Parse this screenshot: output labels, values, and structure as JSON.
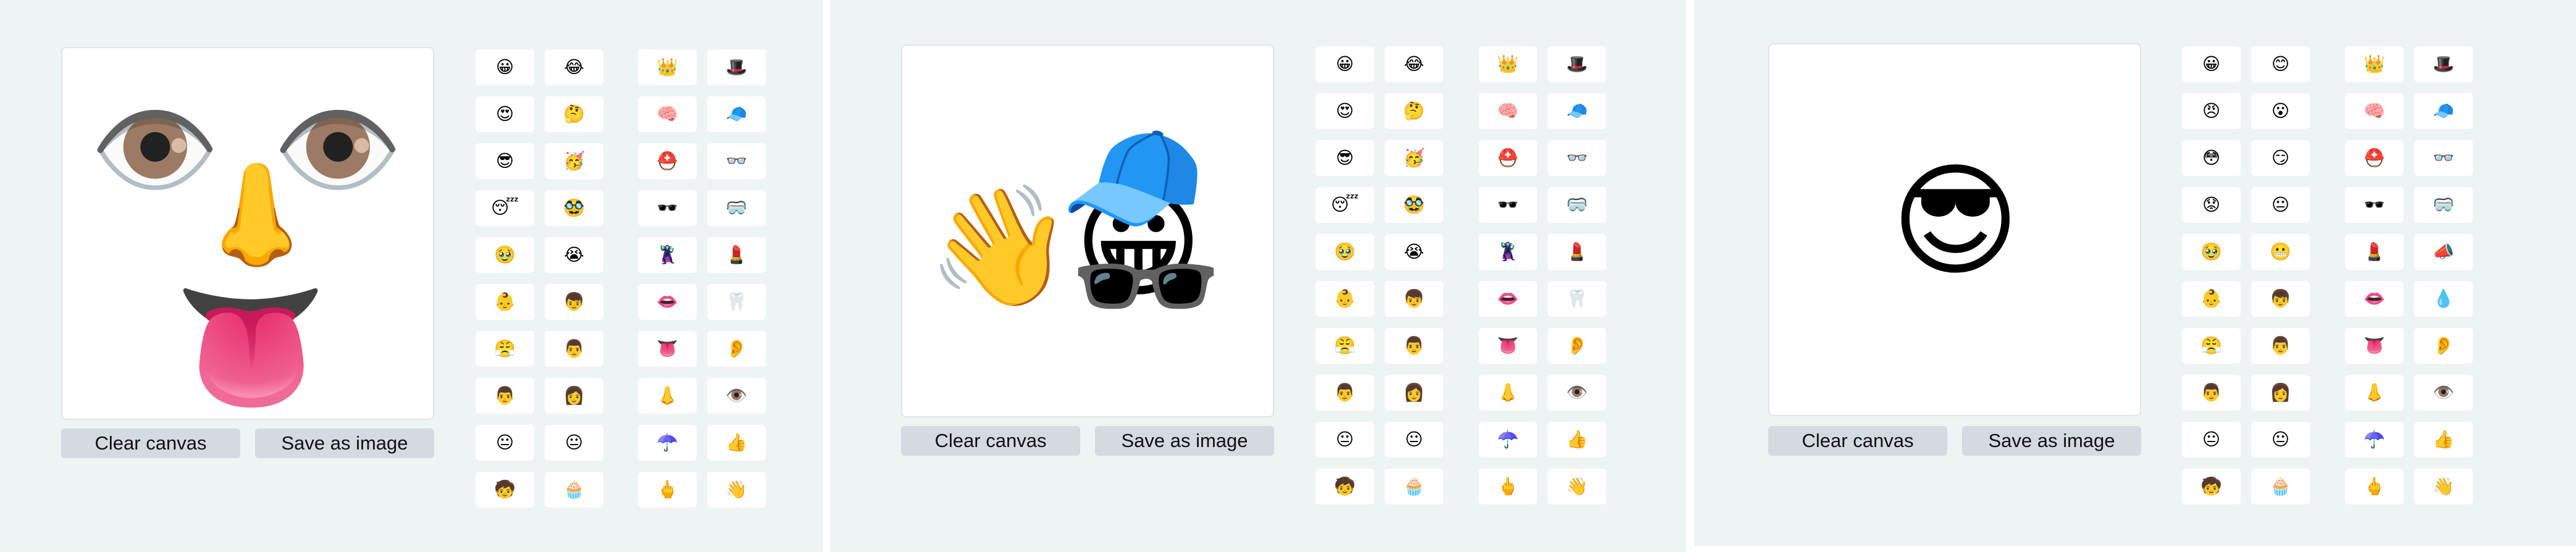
{
  "panels": [
    {
      "placed": [
        {
          "emoji": "👁️",
          "name": "left-eye"
        },
        {
          "emoji": "👁️",
          "name": "right-eye"
        },
        {
          "emoji": "👃",
          "name": "nose"
        },
        {
          "emoji": "👅",
          "name": "tongue"
        }
      ],
      "buttons": {
        "clear": "Clear canvas",
        "save": "Save as image"
      },
      "palette_a": [
        "😀",
        "😂",
        "😍",
        "🤔",
        "😎",
        "🥳",
        "😴",
        "🥸",
        "🥹",
        "😭",
        "👶",
        "👦",
        "😤",
        "👨",
        "👨",
        "👩",
        "😐",
        "😐",
        "🧒",
        "🧁"
      ],
      "palette_b": [
        "👑",
        "🎩",
        "🧠",
        "🧢",
        "⛑️",
        "👓",
        "🕶️",
        "🥽",
        "🦹",
        "💄",
        "👄",
        "🦷",
        "👅",
        "👂",
        "👃",
        "👁️",
        "☂️",
        "👍",
        "🖕",
        "👋"
      ]
    },
    {
      "placed": [
        {
          "emoji": "👋",
          "name": "waving-hand"
        },
        {
          "emoji": "😀",
          "name": "face"
        },
        {
          "emoji": "🧢",
          "name": "blue-cap"
        },
        {
          "emoji": "🕶️",
          "name": "sunglasses"
        }
      ],
      "buttons": {
        "clear": "Clear canvas",
        "save": "Save as image"
      },
      "palette_a": [
        "😀",
        "😂",
        "😍",
        "🤔",
        "😎",
        "🥳",
        "😴",
        "🥸",
        "🥹",
        "😭",
        "👶",
        "👦",
        "😤",
        "👨",
        "👨",
        "👩",
        "😐",
        "😐",
        "🧒",
        "🧁"
      ],
      "palette_b": [
        "👑",
        "🎩",
        "🧠",
        "🧢",
        "⛑️",
        "👓",
        "🕶️",
        "🥽",
        "🦹",
        "💄",
        "👄",
        "🦷",
        "👅",
        "👂",
        "👃",
        "👁️",
        "☂️",
        "👍",
        "🖕",
        "👋"
      ]
    },
    {
      "placed": [
        {
          "emoji": "😎",
          "name": "sunglasses-face"
        }
      ],
      "buttons": {
        "clear": "Clear canvas",
        "save": "Save as image"
      },
      "palette_a": [
        "😀",
        "😊",
        "😠",
        "😮",
        "😳",
        "😏",
        "😟",
        "😐",
        "🥹",
        "😬",
        "👶",
        "👦",
        "😤",
        "👨",
        "👨",
        "👩",
        "😐",
        "😐",
        "🧒",
        "🧁"
      ],
      "palette_b": [
        "👑",
        "🎩",
        "🧠",
        "🧢",
        "⛑️",
        "👓",
        "🕶️",
        "🥽",
        "💄",
        "📣",
        "👄",
        "💧",
        "👅",
        "👂",
        "👃",
        "👁️",
        "☂️",
        "👍",
        "🖕",
        "👋"
      ]
    }
  ]
}
